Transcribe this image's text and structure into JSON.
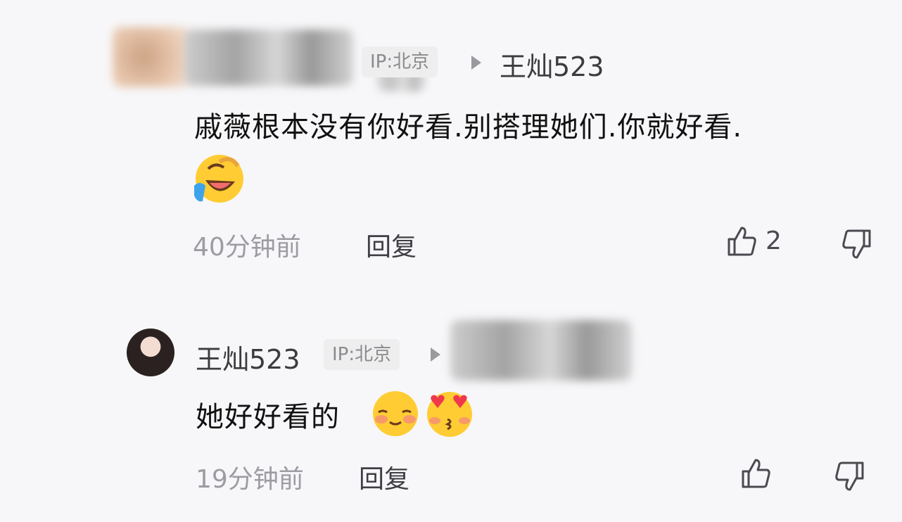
{
  "comments": [
    {
      "ip_label": "IP:北京",
      "reply_target": "王灿523",
      "text": "戚薇根本没有你好看.别搭理她们.你就好看.",
      "emojis": [
        "laughing-crying-emoji"
      ],
      "time": "40分钟前",
      "reply_label": "回复",
      "like_count": "2"
    },
    {
      "username": "王灿523",
      "ip_label": "IP:北京",
      "text": "她好好看的",
      "emojis": [
        "shy-smile-emoji",
        "heart-eyes-kiss-emoji"
      ],
      "time": "19分钟前",
      "reply_label": "回复"
    }
  ],
  "icons": {
    "like": "thumbs-up-outline-icon",
    "dislike": "thumbs-down-outline-icon",
    "reply_arrow": "triangle-right-icon"
  },
  "colors": {
    "background": "#f7f7f9",
    "ip_badge_bg": "#eeeeef",
    "muted_text": "#9c9ca2",
    "emoji_yellow": "#ffcc33"
  }
}
